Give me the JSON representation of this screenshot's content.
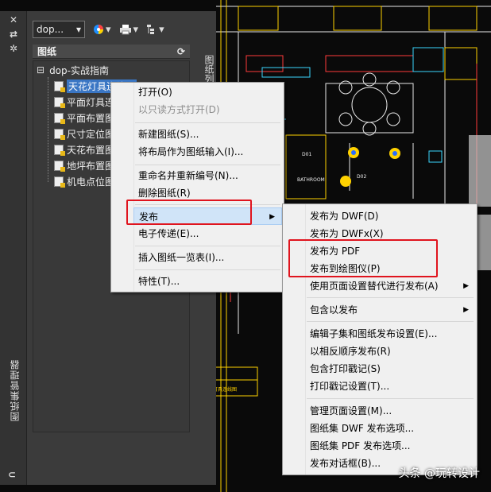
{
  "palette": {
    "title": "图纸集管理器",
    "side_tab": "图纸列表",
    "current_set": "dop...",
    "sheets_header": "图纸",
    "root": "dop-实战指南",
    "sheets": [
      {
        "label": "天花灯具连线图",
        "selected": true
      },
      {
        "label": "平面灯具连线图",
        "selected": false
      },
      {
        "label": "平面布置图",
        "selected": false
      },
      {
        "label": "尺寸定位图",
        "selected": false
      },
      {
        "label": "天花布置图",
        "selected": false
      },
      {
        "label": "地坪布置图",
        "selected": false
      },
      {
        "label": "机电点位图",
        "selected": false
      }
    ],
    "toolbar_icons": [
      "close-icon",
      "auto-hide-icon",
      "settings-icon",
      "color-wheel-icon",
      "printer-icon",
      "organize-icon"
    ]
  },
  "context_menu": {
    "items": [
      {
        "label": "打开(O)",
        "disabled": false
      },
      {
        "label": "以只读方式打开(D)",
        "disabled": true
      },
      {
        "label": "新建图纸(S)...",
        "disabled": false
      },
      {
        "label": "将布局作为图纸输入(I)...",
        "disabled": false
      },
      {
        "label": "重命名并重新编号(N)...",
        "disabled": false
      },
      {
        "label": "删除图纸(R)",
        "disabled": false
      },
      {
        "label": "发布",
        "disabled": false,
        "submenu": true,
        "highlighted": true
      },
      {
        "label": "电子传递(E)...",
        "disabled": false
      },
      {
        "label": "插入图纸一览表(I)...",
        "disabled": false
      },
      {
        "label": "特性(T)...",
        "disabled": false
      }
    ]
  },
  "publish_menu": {
    "items": [
      {
        "label": "发布为 DWF(D)"
      },
      {
        "label": "发布为 DWFx(X)"
      },
      {
        "label": "发布为 PDF"
      },
      {
        "label": "发布到绘图仪(P)"
      },
      {
        "label": "使用页面设置替代进行发布(A)",
        "submenu": true
      },
      {
        "label": "包含以发布",
        "submenu": true
      },
      {
        "label": "编辑子集和图纸发布设置(E)..."
      },
      {
        "label": "以相反顺序发布(R)"
      },
      {
        "label": "包含打印戳记(S)"
      },
      {
        "label": "打印戳记设置(T)..."
      },
      {
        "label": "管理页面设置(M)..."
      },
      {
        "label": "图纸集 DWF 发布选项..."
      },
      {
        "label": "图纸集 PDF 发布选项..."
      },
      {
        "label": "发布对话框(B)..."
      }
    ]
  },
  "drawing": {
    "room_label": "BATHROOM",
    "door_tags": [
      "D01",
      "D02"
    ],
    "table_text": [
      "备注",
      "天花灯具连线图"
    ]
  },
  "watermark": "头条 @玩转设计",
  "colors": {
    "cad_bg": "#0a0a0a",
    "highlight_border": "#e0141e",
    "selection": "#3a76c4"
  }
}
